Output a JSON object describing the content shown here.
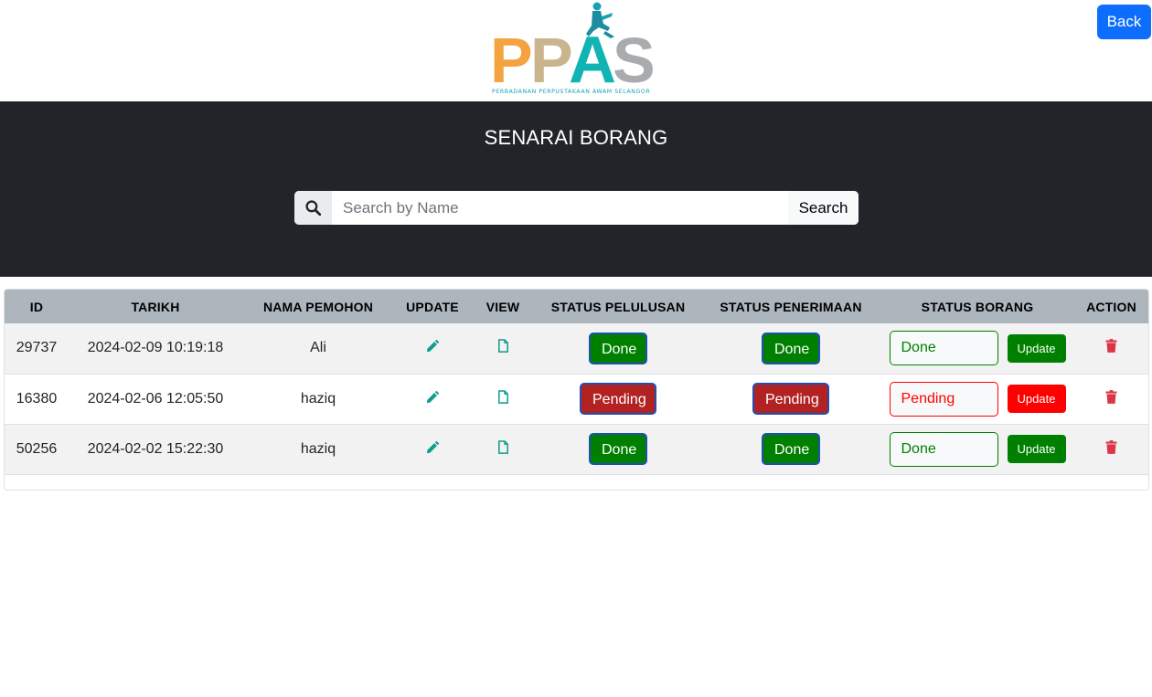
{
  "logo": {
    "text": "PPAS",
    "subtitle": "PERBADANAN PERPUSTAKAAN AWAM SELANGOR"
  },
  "back_label": "Back",
  "page_title": "SENARAI BORANG",
  "search": {
    "placeholder": "Search by Name",
    "button_label": "Search",
    "icon": "search-icon"
  },
  "colors": {
    "accent": "#0d6efd",
    "band": "#212529",
    "done": "#008000",
    "pending": "#b22222",
    "update_pending": "#ff0000",
    "icon_teal": "#0f9b8e",
    "trash_red": "#dc3545"
  },
  "table": {
    "headers": [
      "ID",
      "TARIKH",
      "NAMA PEMOHON",
      "UPDATE",
      "VIEW",
      "STATUS PELULUSAN",
      "STATUS PENERIMAAN",
      "STATUS BORANG",
      "ACTION"
    ],
    "rows": [
      {
        "id": "29737",
        "tarikh": "2024-02-09 10:19:18",
        "nama": "Ali",
        "pelulusan": "Done",
        "penerimaan": "Done",
        "borang": "Done",
        "update_label": "Update"
      },
      {
        "id": "16380",
        "tarikh": "2024-02-06 12:05:50",
        "nama": "haziq",
        "pelulusan": "Pending",
        "penerimaan": "Pending",
        "borang": "Pending",
        "update_label": "Update"
      },
      {
        "id": "50256",
        "tarikh": "2024-02-02 15:22:30",
        "nama": "haziq",
        "pelulusan": "Done",
        "penerimaan": "Done",
        "borang": "Done",
        "update_label": "Update"
      }
    ]
  }
}
